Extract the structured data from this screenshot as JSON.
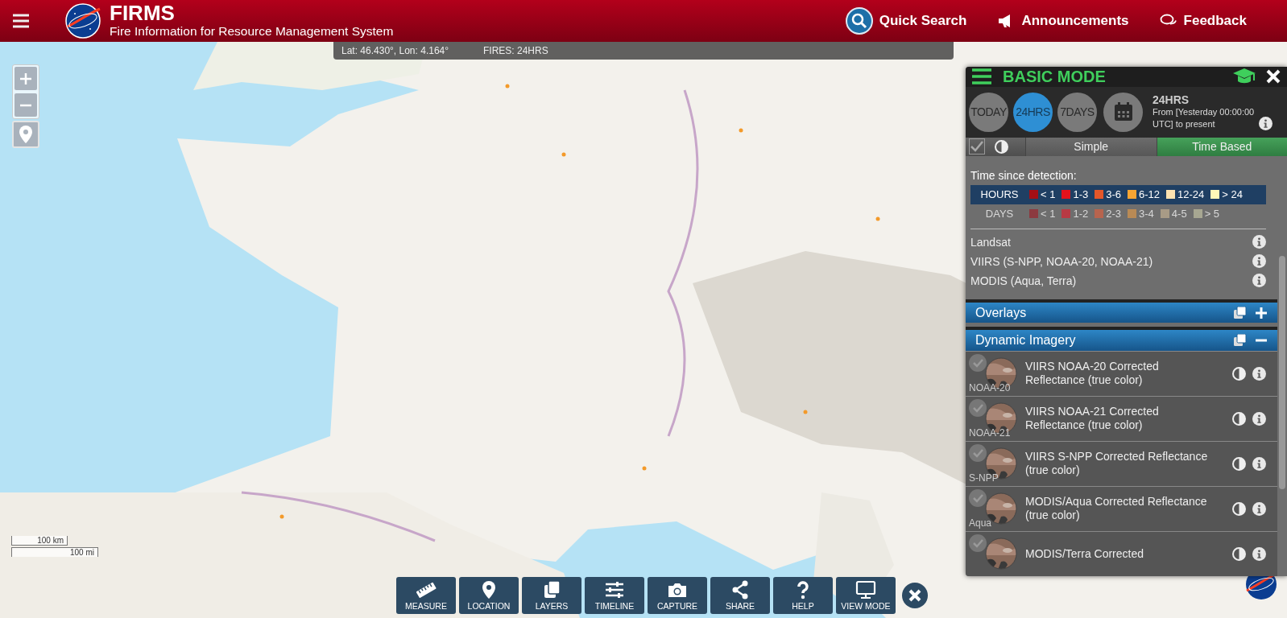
{
  "header": {
    "title": "FIRMS",
    "subtitle": "Fire Information for Resource Management System",
    "links": [
      {
        "label": "Quick Search",
        "kind": "search"
      },
      {
        "label": "Announcements",
        "kind": "megaphone"
      },
      {
        "label": "Feedback",
        "kind": "chat"
      }
    ]
  },
  "map": {
    "kind": "picture",
    "coordinates": "Lat: 46.430°, Lon: 4.164°",
    "fires_label": "FIRES: 24HRS",
    "scale": [
      "100 km",
      "100 mi"
    ]
  },
  "panel": {
    "title": "BASIC MODE",
    "periods": [
      {
        "label": "TODAY",
        "selected": false
      },
      {
        "label": "24HRS",
        "selected": true
      },
      {
        "label": "7DAYS",
        "selected": false
      }
    ],
    "period_title": "24HRS",
    "period_text": "From [Yesterday 00:00:00 UTC] to present",
    "visibility_checked": true,
    "style_tabs": [
      {
        "label": "Simple",
        "selected": false
      },
      {
        "label": "Time Based",
        "selected": true
      }
    ],
    "legend_title": "Time since detection:",
    "legend_rows": [
      {
        "label": "HOURS",
        "selected": true,
        "items": [
          {
            "label": "< 1",
            "color": "#a50f15"
          },
          {
            "label": "1-3",
            "color": "#e3121c"
          },
          {
            "label": "3-6",
            "color": "#e4572a"
          },
          {
            "label": "6-12",
            "color": "#f7a533"
          },
          {
            "label": "12-24",
            "color": "#fde2b0"
          },
          {
            "label": "> 24",
            "color": "#fdf9b8"
          }
        ]
      },
      {
        "label": "DAYS",
        "selected": false,
        "items": [
          {
            "label": "< 1",
            "color": "#8c3a40"
          },
          {
            "label": "1-2",
            "color": "#b83a44"
          },
          {
            "label": "2-3",
            "color": "#b7644e"
          },
          {
            "label": "3-4",
            "color": "#b98a55"
          },
          {
            "label": "4-5",
            "color": "#a89b86"
          },
          {
            "label": "> 5",
            "color": "#a7a792"
          }
        ]
      }
    ],
    "sources": [
      "Landsat",
      "VIIRS (S-NPP, NOAA-20, NOAA-21)",
      "MODIS (Aqua, Terra)"
    ],
    "sections": [
      {
        "label": "Overlays",
        "expanded": false
      },
      {
        "label": "Dynamic Imagery",
        "expanded": true
      }
    ],
    "layers": [
      {
        "title": "VIIRS NOAA-20 Corrected Reflectance (true color)",
        "badge": "NOAA-20",
        "checked": false
      },
      {
        "title": "VIIRS NOAA-21 Corrected Reflectance (true color)",
        "badge": "NOAA-21",
        "checked": false
      },
      {
        "title": "VIIRS S-NPP Corrected Reflectance (true color)",
        "badge": "S-NPP",
        "checked": false
      },
      {
        "title": "MODIS/Aqua Corrected Reflectance (true color)",
        "badge": "Aqua",
        "checked": false
      },
      {
        "title": "MODIS/Terra Corrected",
        "checked": false
      }
    ]
  },
  "toolbar": [
    {
      "label": "MEASURE",
      "kind": "ruler"
    },
    {
      "label": "LOCATION",
      "kind": "pin"
    },
    {
      "label": "LAYERS",
      "kind": "layers"
    },
    {
      "label": "TIMELINE",
      "kind": "sliders"
    },
    {
      "label": "CAPTURE",
      "kind": "camera"
    },
    {
      "label": "SHARE",
      "kind": "share"
    },
    {
      "label": "HELP",
      "kind": "help"
    },
    {
      "label": "VIEW MODE",
      "kind": "monitor"
    }
  ]
}
